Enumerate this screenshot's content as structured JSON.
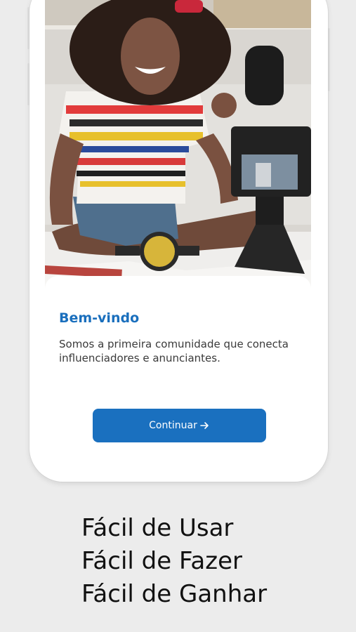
{
  "welcome": {
    "title": "Bem-vindo",
    "description": "Somos a primeira comunidade que conecta influenciadores e anunciantes.",
    "continue_label": "Continuar",
    "continue_icon": "arrow-right-icon"
  },
  "taglines": [
    "Fácil de Usar",
    "Fácil de Fazer",
    "Fácil de Ganhar"
  ],
  "colors": {
    "accent": "#1a70bf",
    "title": "#1a6fbd",
    "background": "#ececec"
  }
}
